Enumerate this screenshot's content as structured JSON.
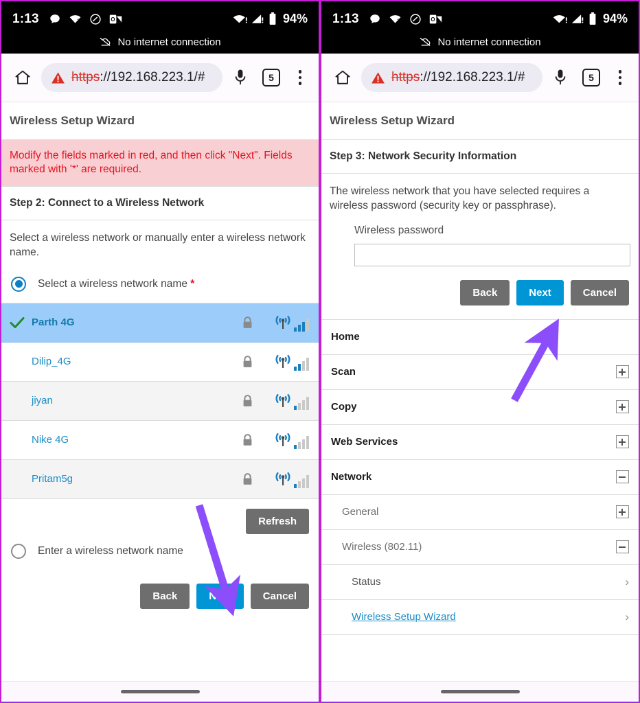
{
  "status_bar": {
    "time": "1:13",
    "battery_percent": "94%",
    "left_icons": [
      "chat-bubble-icon",
      "wifi-question-icon",
      "clock-icon",
      "outlook-icon"
    ],
    "right_icons": [
      "wifi-alert-icon",
      "cellular-alert-icon",
      "battery-icon"
    ],
    "offline_text": "No internet connection",
    "offline_icon": "cloud-off-icon"
  },
  "browser": {
    "home_icon": "home-icon",
    "warning_icon": "warning-triangle-icon",
    "url_scheme": "https",
    "url_rest": "://192.168.223.1/#",
    "mic_icon": "microphone-icon",
    "tab_count": "5",
    "menu_icon": "overflow-menu-icon"
  },
  "left_panel": {
    "card_title": "Wireless Setup Wizard",
    "alert": "Modify the fields marked in red, and then click \"Next\". Fields marked with '*' are required.",
    "step_heading": "Step 2: Connect to a Wireless Network",
    "intro": "Select a wireless network or manually enter a wireless network name.",
    "radio_select_label": "Select a wireless network name",
    "required_marker": "*",
    "radio_manual_label": "Enter a wireless network name",
    "networks": [
      {
        "name": "Parth 4G",
        "selected": true,
        "locked": true,
        "signal": 3
      },
      {
        "name": "Dilip_4G",
        "selected": false,
        "locked": true,
        "signal": 2
      },
      {
        "name": "jiyan",
        "selected": false,
        "locked": true,
        "signal": 1
      },
      {
        "name": "Nike 4G",
        "selected": false,
        "locked": true,
        "signal": 1
      },
      {
        "name": "Pritam5g",
        "selected": false,
        "locked": true,
        "signal": 1
      }
    ],
    "refresh_label": "Refresh",
    "back_label": "Back",
    "next_label": "Next",
    "cancel_label": "Cancel"
  },
  "right_panel": {
    "card_title": "Wireless Setup Wizard",
    "step_heading": "Step 3: Network Security Information",
    "intro": "The wireless network that you have selected requires a wireless password (security key or passphrase).",
    "password_label": "Wireless password",
    "password_value": "",
    "password_placeholder": "",
    "back_label": "Back",
    "next_label": "Next",
    "cancel_label": "Cancel",
    "menu": [
      {
        "label": "Home",
        "level": 1,
        "control": "none",
        "link": false
      },
      {
        "label": "Scan",
        "level": 1,
        "control": "plus",
        "link": false
      },
      {
        "label": "Copy",
        "level": 1,
        "control": "plus",
        "link": false
      },
      {
        "label": "Web Services",
        "level": 1,
        "control": "plus",
        "link": false
      },
      {
        "label": "Network",
        "level": 1,
        "control": "minus",
        "link": false
      },
      {
        "label": "General",
        "level": 2,
        "control": "plus",
        "link": false
      },
      {
        "label": "Wireless (802.11)",
        "level": 2,
        "control": "minus",
        "link": false
      },
      {
        "label": "Status",
        "level": 3,
        "control": "chev",
        "link": false
      },
      {
        "label": "Wireless Setup Wizard",
        "level": 3,
        "control": "chev",
        "link": true
      }
    ]
  },
  "colors": {
    "accent_blue": "#0096d6",
    "grey_button": "#6e6e6e",
    "alert_red": "#e8121e",
    "alert_bg": "#f8d0d4",
    "selection_blue": "#9ccdfa",
    "link_blue": "#1b8ec7",
    "annotation_purple": "#8c4dfa",
    "frame_magenta": "#c21fd4"
  }
}
